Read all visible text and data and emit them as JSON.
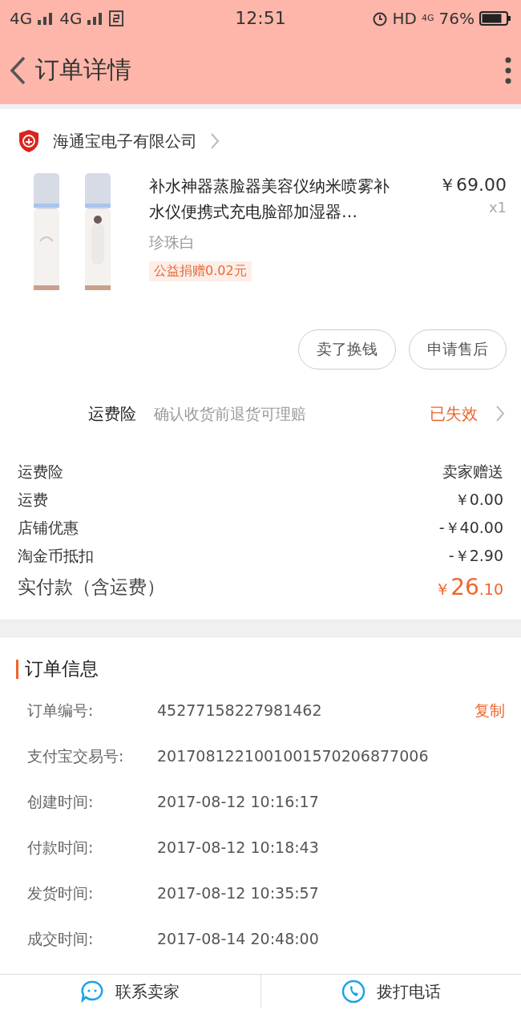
{
  "status_bar": {
    "carrier_1": "4G",
    "carrier_2": "4G",
    "time": "12:51",
    "hd": "HD",
    "network": "4G",
    "battery": "76%"
  },
  "nav": {
    "title": "订单详情"
  },
  "shop": {
    "name": "海通宝电子有限公司"
  },
  "product": {
    "title": "补水神器蒸脸器美容仪纳米喷雾补水仪便携式充电脸部加湿器…",
    "price": "￥69.00",
    "quantity": "x1",
    "variant": "珍珠白",
    "charity": "公益捐赠0.02元"
  },
  "actions": [
    "卖了换钱",
    "申请售后"
  ],
  "insurance": {
    "label": "运费险",
    "description": "确认收货前退货可理赔",
    "status": "已失效"
  },
  "fees": [
    {
      "label": "运费险",
      "value": "卖家赠送"
    },
    {
      "label": "运费",
      "value": "￥0.00"
    },
    {
      "label": "店铺优惠",
      "value": "-￥40.00"
    },
    {
      "label": "淘金币抵扣",
      "value": "-￥2.90"
    }
  ],
  "total": {
    "label": "实付款（含运费）",
    "currency": "￥",
    "integer": "26",
    "decimal": ".10"
  },
  "order_info": {
    "title": "订单信息",
    "copy": "复制",
    "rows": [
      {
        "label": "订单编号:",
        "value": "45277158227981462"
      },
      {
        "label": "支付宝交易号:",
        "value": "2017081221001001570206877006"
      },
      {
        "label": "创建时间:",
        "value": "2017-08-12 10:16:17"
      },
      {
        "label": "付款时间:",
        "value": "2017-08-12 10:18:43"
      },
      {
        "label": "发货时间:",
        "value": "2017-08-12 10:35:57"
      },
      {
        "label": "成交时间:",
        "value": "2017-08-14 20:48:00"
      }
    ]
  },
  "bottom_bar": [
    {
      "kind": "chat",
      "label": "联系卖家"
    },
    {
      "kind": "phone",
      "label": "拨打电话"
    }
  ]
}
